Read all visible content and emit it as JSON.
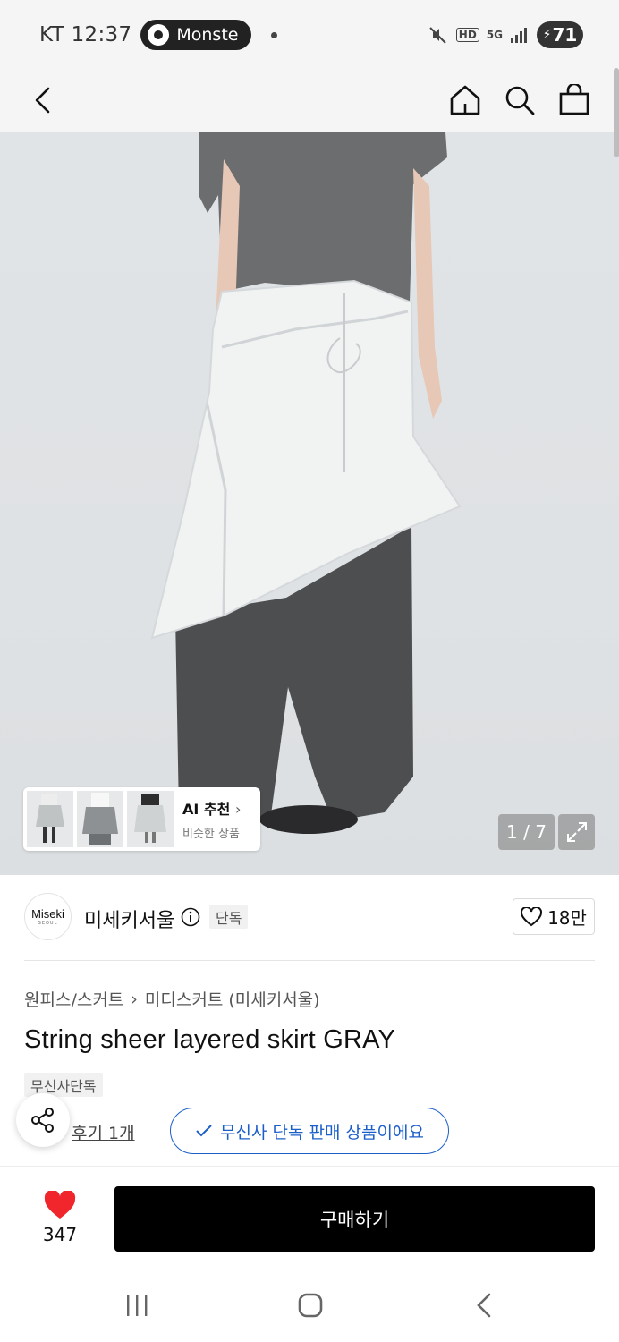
{
  "status_bar": {
    "carrier": "KT",
    "time": "12:37",
    "pill_text": "Monste",
    "hd": "HD",
    "network": "5G",
    "battery": "71"
  },
  "header": {
    "back_icon": "chevron-left-icon",
    "home_icon": "home-icon",
    "search_icon": "search-icon",
    "cart_icon": "shopping-bag-icon"
  },
  "hero": {
    "ai_title": "AI 추천",
    "ai_subtitle": "비슷한 상품",
    "counter": "1 / 7"
  },
  "brand": {
    "logo_text": "Miseki",
    "logo_sub": "SEOUL",
    "name": "미세키서울",
    "badge": "단독",
    "likes": "18만"
  },
  "product": {
    "breadcrumb_category": "원피스/스커트",
    "breadcrumb_sub": "미디스커트 (미세키서울)",
    "title": "String sheer layered skirt GRAY",
    "exclusive_tag": "무신사단독",
    "review": "후기 1개",
    "exclusive_notice": "무신사 단독 판매 상품이에요"
  },
  "bottom_bar": {
    "wish_count": "347",
    "buy_label": "구매하기"
  },
  "colors": {
    "accent_blue": "#1c5fc9",
    "heart_red": "#f0262c",
    "buy_button": "#000000"
  }
}
